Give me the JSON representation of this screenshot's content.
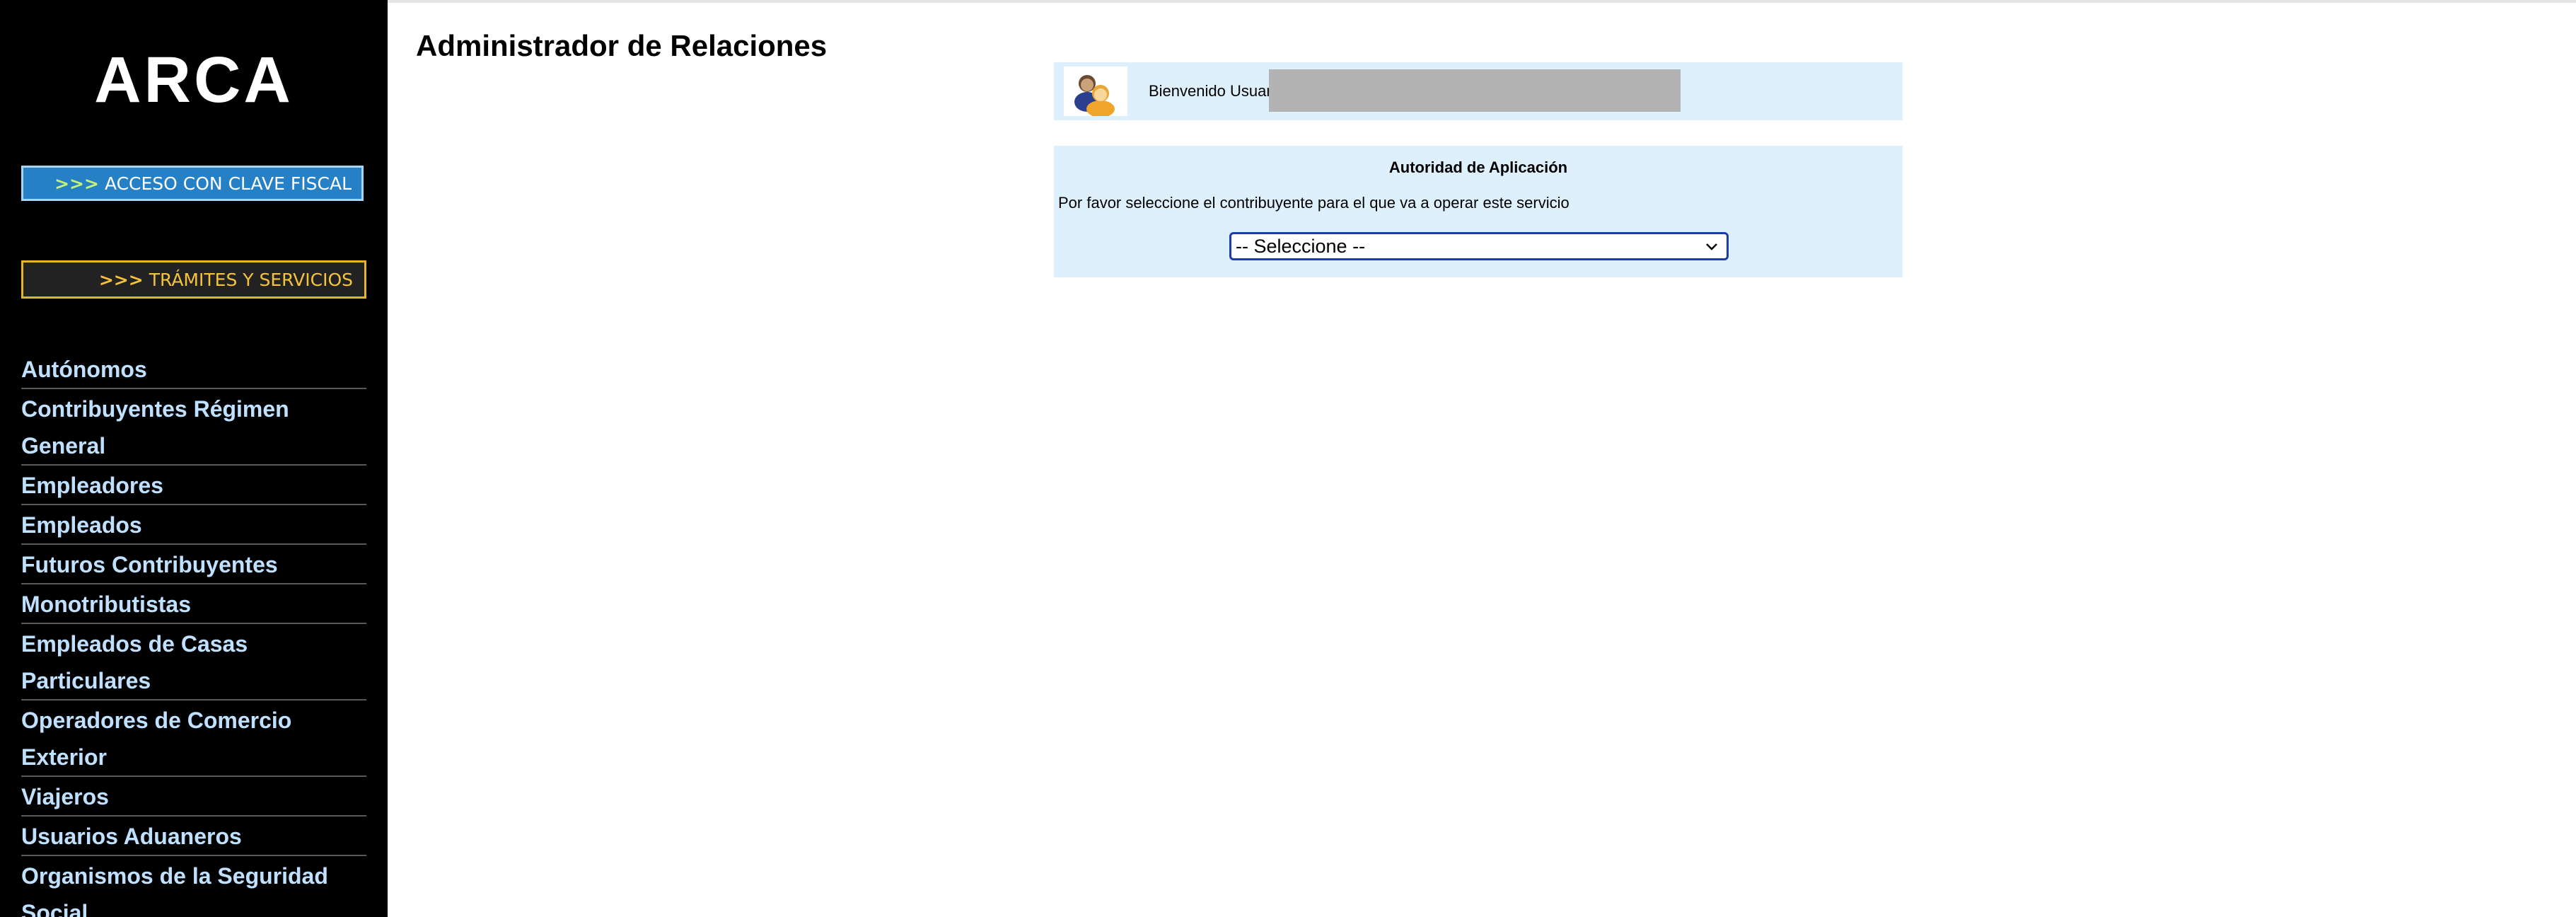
{
  "sidebar": {
    "logo": "ARCA",
    "clave_fiscal_arrows": ">>>",
    "clave_fiscal_label": "ACCESO CON CLAVE FISCAL",
    "tramites_arrows": ">>>",
    "tramites_label": "TRÁMITES Y SERVICIOS",
    "nav_items": [
      {
        "label": "Autónomos"
      },
      {
        "label": "Contribuyentes Régimen General"
      },
      {
        "label": "Empleadores"
      },
      {
        "label": "Empleados"
      },
      {
        "label": "Futuros Contribuyentes"
      },
      {
        "label": "Monotributistas"
      },
      {
        "label": "Empleados de Casas Particulares"
      },
      {
        "label": "Operadores de Comercio Exterior"
      },
      {
        "label": "Viajeros"
      },
      {
        "label": "Usuarios Aduaneros"
      },
      {
        "label": "Organismos de la Seguridad Social"
      }
    ]
  },
  "main": {
    "title": "Administrador de Relaciones",
    "welcome_text": "Bienvenido Usuar",
    "authority_title": "Autoridad de Aplicación",
    "instruction": "Por favor seleccione el contribuyente para el que va a operar este servicio",
    "select_value": "-- Seleccione --"
  },
  "colors": {
    "sidebar_bg": "#000000",
    "nav_link": "#bfe0ff",
    "clave_button": "#2680c5",
    "tramites_border": "#e6b32a",
    "panel_bg": "#dff0fd",
    "select_border": "#1a3ea8"
  },
  "icons": {
    "user": "users-icon",
    "dropdown": "chevron-down-icon"
  }
}
